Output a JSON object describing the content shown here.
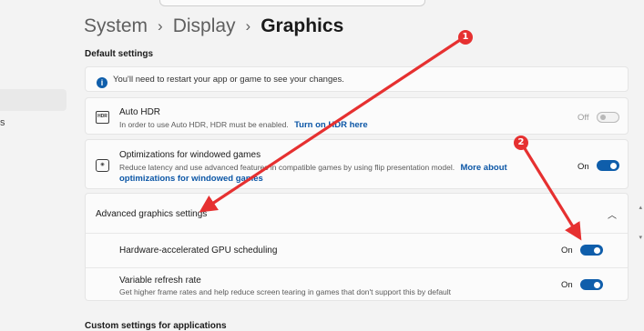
{
  "breadcrumb": {
    "items": [
      "System",
      "Display",
      "Graphics"
    ],
    "separator": "›"
  },
  "sidebar": {
    "fragment": "s"
  },
  "sections": {
    "default_settings": "Default settings",
    "custom_settings": "Custom settings for applications"
  },
  "info_banner": {
    "text": "You'll need to restart your app or game to see your changes.",
    "icon": "info-icon"
  },
  "auto_hdr": {
    "title": "Auto HDR",
    "desc_prefix": "In order to use Auto HDR, HDR must be enabled.",
    "link": "Turn on HDR here",
    "state": "Off",
    "toggle": "off",
    "icon": "hdr-icon"
  },
  "windowed_games": {
    "title": "Optimizations for windowed games",
    "desc_line1": "Reduce latency and use advanced features in compatible games by using flip presentation model.",
    "link_line1": "More about",
    "link_line2": "optimizations for windowed games",
    "state": "On",
    "toggle": "on",
    "icon": "window-game-icon"
  },
  "advanced": {
    "header": "Advanced graphics settings",
    "chevron": "chevron-up-icon",
    "gpu_scheduling": {
      "title": "Hardware-accelerated GPU scheduling",
      "state": "On",
      "toggle": "on"
    },
    "vrr": {
      "title": "Variable refresh rate",
      "desc": "Get higher frame rates and help reduce screen tearing in games that don't support this by default",
      "state": "On",
      "toggle": "on"
    }
  },
  "annotations": {
    "badge1": "1",
    "badge2": "2",
    "color": "#e63030"
  },
  "colors": {
    "accent": "#0f5eab",
    "link": "#0b56a6",
    "background": "#f3f3f3",
    "card": "#fbfbfb"
  }
}
